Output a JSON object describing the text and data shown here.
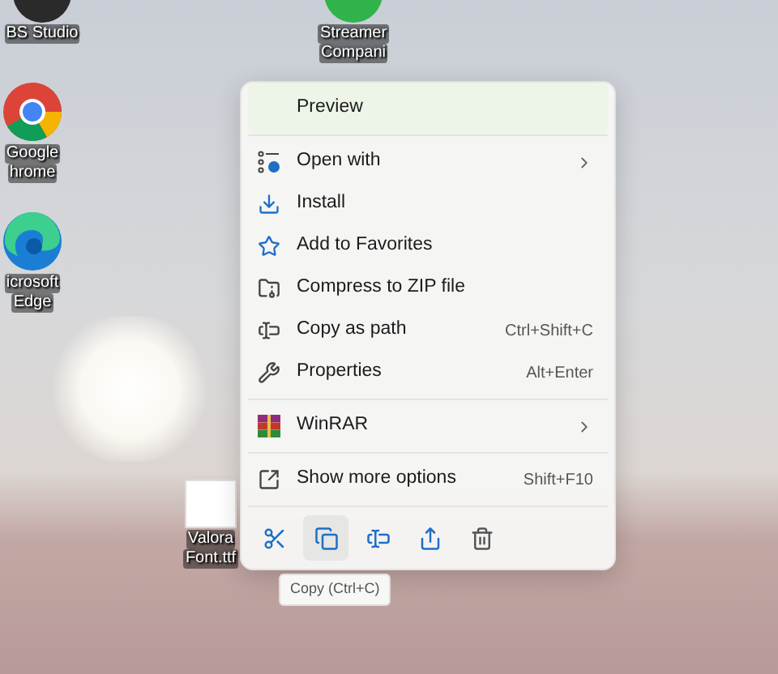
{
  "desktop_icons": [
    {
      "kind": "obs",
      "lines": [
        "BS Studio"
      ]
    },
    {
      "kind": "streamer",
      "lines": [
        "Streamer",
        "Compani"
      ]
    },
    {
      "kind": "chrome",
      "lines": [
        "Google",
        "hrome"
      ]
    },
    {
      "kind": "edge",
      "lines": [
        "icrosoft",
        "Edge"
      ]
    },
    {
      "kind": "font",
      "lines": [
        "Valora",
        "Font.ttf"
      ]
    }
  ],
  "context_menu": {
    "groups": [
      [
        {
          "kind": "preview",
          "label": "Preview"
        }
      ],
      [
        {
          "kind": "open_with",
          "label": "Open with",
          "submenu": true
        },
        {
          "kind": "install",
          "label": "Install"
        },
        {
          "kind": "favorite",
          "label": "Add to Favorites"
        },
        {
          "kind": "compress",
          "label": "Compress to ZIP file"
        },
        {
          "kind": "copy_path",
          "label": "Copy as path",
          "shortcut": "Ctrl+Shift+C"
        },
        {
          "kind": "properties",
          "label": "Properties",
          "shortcut": "Alt+Enter"
        }
      ],
      [
        {
          "kind": "winrar",
          "label": "WinRAR",
          "submenu": true
        }
      ],
      [
        {
          "kind": "more",
          "label": "Show more options",
          "shortcut": "Shift+F10"
        }
      ]
    ],
    "toolbar": [
      {
        "kind": "cut",
        "selected": false
      },
      {
        "kind": "copy",
        "selected": true
      },
      {
        "kind": "rename",
        "selected": false
      },
      {
        "kind": "share",
        "selected": false
      },
      {
        "kind": "delete",
        "selected": false
      }
    ]
  },
  "tooltip": {
    "text": "Copy (Ctrl+C)"
  }
}
